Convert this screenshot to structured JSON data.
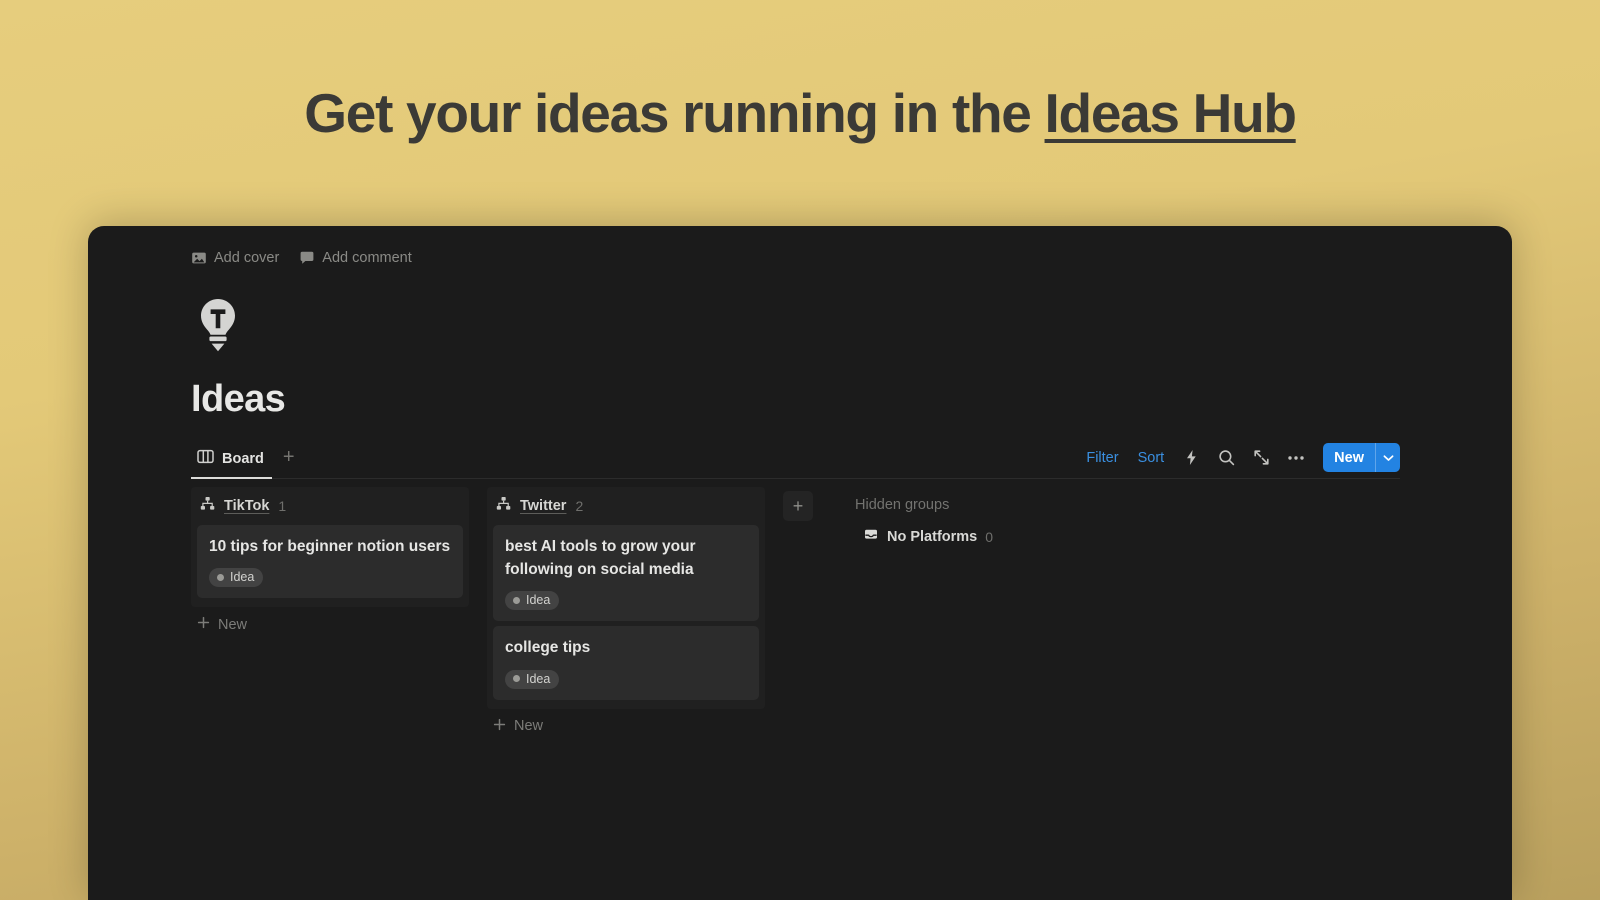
{
  "headline": {
    "prefix": "Get your ideas running in the ",
    "emphasis": "Ideas Hub"
  },
  "window": {
    "page_controls": [
      {
        "label": "Add cover",
        "icon": "image-icon"
      },
      {
        "label": "Add comment",
        "icon": "comment-icon"
      }
    ],
    "page": {
      "icon": "lightbulb-icon",
      "icon_letter": "T",
      "title": "Ideas"
    },
    "viewbar": {
      "tabs": [
        {
          "label": "Board",
          "icon": "board-icon"
        }
      ],
      "add_view_label": "+",
      "actions": {
        "filter_label": "Filter",
        "sort_label": "Sort",
        "icons": [
          {
            "name": "automation-bolt-icon"
          },
          {
            "name": "search-icon"
          },
          {
            "name": "expand-icon"
          },
          {
            "name": "more-options-icon"
          }
        ],
        "new_label": "New",
        "new_chevron": "chevron-down-icon"
      }
    },
    "board": {
      "columns": [
        {
          "name": "TikTok",
          "count": "1",
          "icon": "relation-icon",
          "cards": [
            {
              "title": "10 tips for beginner notion users",
              "tag": "Idea"
            }
          ],
          "new_label": "New"
        },
        {
          "name": "Twitter",
          "count": "2",
          "icon": "relation-icon",
          "cards": [
            {
              "title": "best AI tools to grow your following on social media",
              "tag": "Idea"
            },
            {
              "title": "college tips",
              "tag": "Idea"
            }
          ],
          "new_label": "New"
        }
      ],
      "add_group_label": "+",
      "hidden_groups": {
        "title": "Hidden groups",
        "items": [
          {
            "name": "No Platforms",
            "count": "0",
            "icon": "inbox-icon"
          }
        ]
      }
    }
  },
  "colors": {
    "accent_blue": "#2383e2",
    "link_blue": "#3a8fe0",
    "window_bg": "#1b1b1b",
    "column_bg": "#202020",
    "card_bg": "#2c2c2c",
    "page_gold": "#e3c978"
  }
}
